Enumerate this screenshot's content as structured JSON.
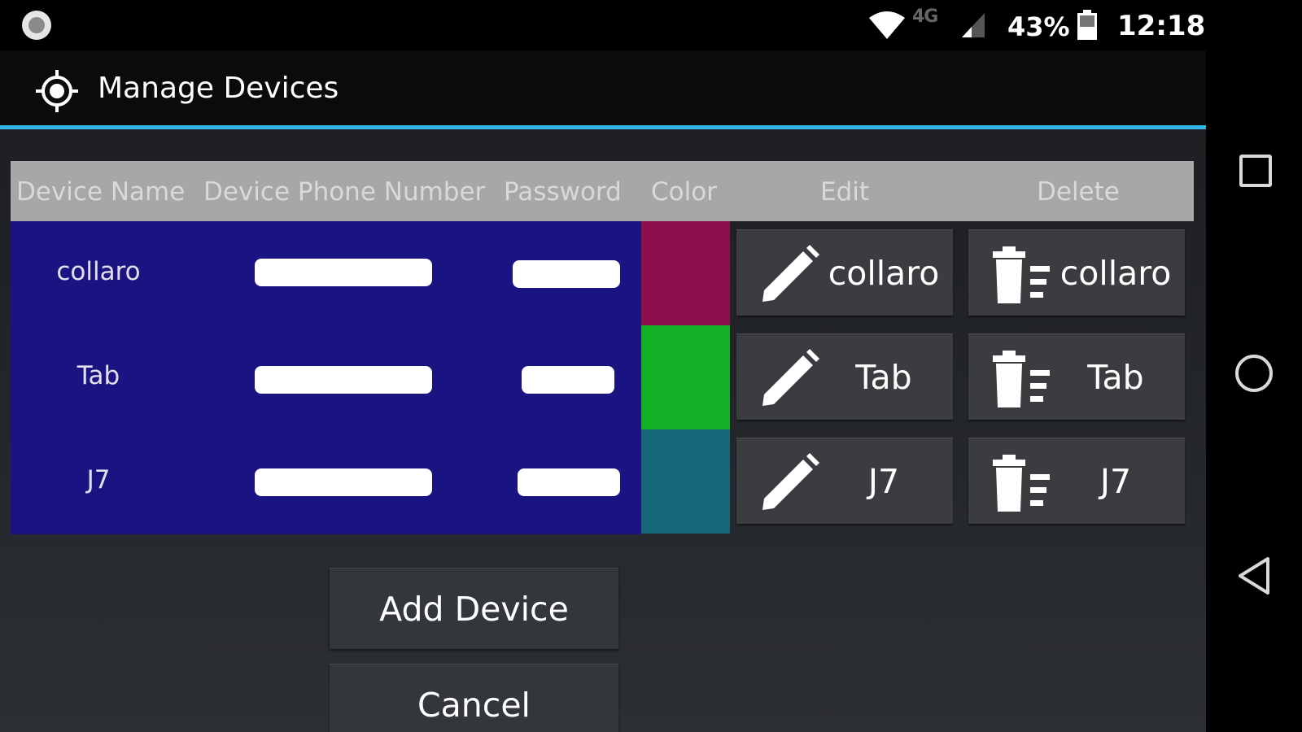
{
  "status_bar": {
    "network": "4G",
    "battery_percent": "43%",
    "time": "12:18"
  },
  "app": {
    "title": "Manage Devices",
    "accent_color": "#33b5e5"
  },
  "table": {
    "headers": [
      "Device Name",
      "Device Phone Number",
      "Password",
      "Color",
      "Edit",
      "Delete"
    ],
    "rows": [
      {
        "name": "collaro",
        "color": "#8b0f4c",
        "edit_label": "collaro",
        "delete_label": "collaro"
      },
      {
        "name": "Tab",
        "color": "#12b024",
        "edit_label": "Tab",
        "delete_label": "Tab"
      },
      {
        "name": "J7",
        "color": "#16677a",
        "edit_label": "J7",
        "delete_label": "J7"
      }
    ]
  },
  "buttons": {
    "add": "Add Device",
    "cancel": "Cancel"
  },
  "icons": {
    "edit": "pencil-icon",
    "delete": "trash-icon",
    "app": "crosshair-icon"
  }
}
